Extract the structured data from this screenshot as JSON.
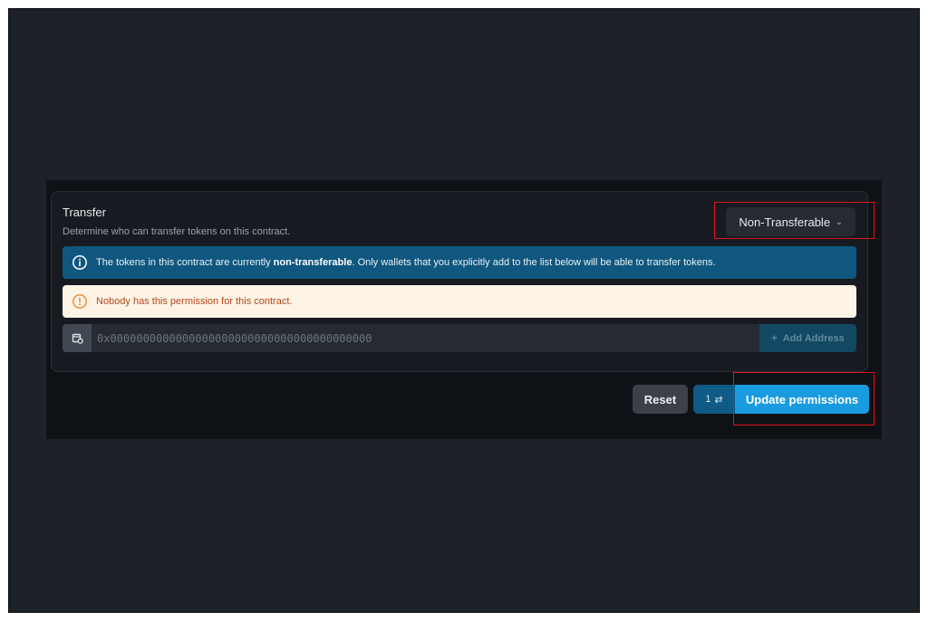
{
  "section": {
    "title": "Transfer",
    "subtitle": "Determine who can transfer tokens on this contract."
  },
  "mode_select": {
    "value": "Non-Transferable",
    "chevron": "chevron-down-icon"
  },
  "info_banner": {
    "icon": "info-icon",
    "text_before": "The tokens in this contract are currently ",
    "text_bold": "non-transferable",
    "text_after": ". Only wallets that you explicitly add to the list below will be able to transfer tokens."
  },
  "warning_banner": {
    "icon": "warning-icon",
    "text": "Nobody has this permission for this contract."
  },
  "address_input": {
    "icon": "wallet-icon",
    "placeholder": "0x0000000000000000000000000000000000000000",
    "value": ""
  },
  "add_address_button": {
    "icon": "plus-icon",
    "label": "Add Address"
  },
  "reset_button": {
    "label": "Reset"
  },
  "pending_count": {
    "value": "1",
    "icon": "swap-icon"
  },
  "update_button": {
    "label": "Update permissions"
  },
  "colors": {
    "background": "#1d2128",
    "info": "#10577f",
    "warning_bg": "#fdf4e6",
    "warning_text": "#b5471b",
    "primary": "#1a9be0",
    "highlight": "#e0141a"
  }
}
